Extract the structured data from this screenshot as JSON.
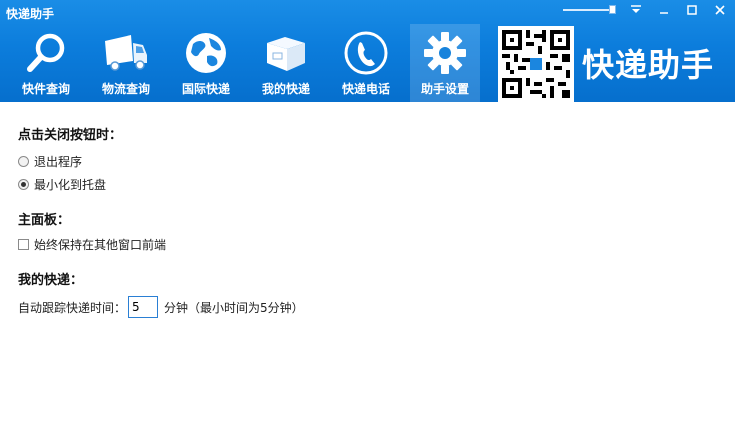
{
  "window": {
    "title": "快递助手",
    "controls": {
      "dropdown_icon": "chevron-down-icon",
      "minimize_icon": "minimize-icon",
      "maximize_icon": "maximize-icon",
      "close_icon": "close-icon"
    }
  },
  "toolbar": {
    "items": [
      {
        "label": "快件查询",
        "icon": "search-icon"
      },
      {
        "label": "物流查询",
        "icon": "truck-icon"
      },
      {
        "label": "国际快递",
        "icon": "globe-icon"
      },
      {
        "label": "我的快递",
        "icon": "package-icon"
      },
      {
        "label": "快递电话",
        "icon": "phone-icon"
      },
      {
        "label": "助手设置",
        "icon": "gear-icon"
      }
    ],
    "active_index": 5
  },
  "brand": {
    "text": "快递助手",
    "qr_icon": "qr-code-icon"
  },
  "colors": {
    "header": "#0c7ddc",
    "accent": "#2a7fd4"
  },
  "settings": {
    "close_behavior": {
      "title": "点击关闭按钮时：",
      "options": [
        {
          "label": "退出程序",
          "checked": false
        },
        {
          "label": "最小化到托盘",
          "checked": true
        }
      ]
    },
    "main_panel": {
      "title": "主面板：",
      "always_on_top_label": "始终保持在其他窗口前端",
      "always_on_top_checked": false
    },
    "my_express": {
      "title": "我的快递：",
      "auto_track_label": "自动跟踪快递时间：",
      "auto_track_value": "5",
      "unit_note": "分钟（最小时间为5分钟）"
    }
  }
}
